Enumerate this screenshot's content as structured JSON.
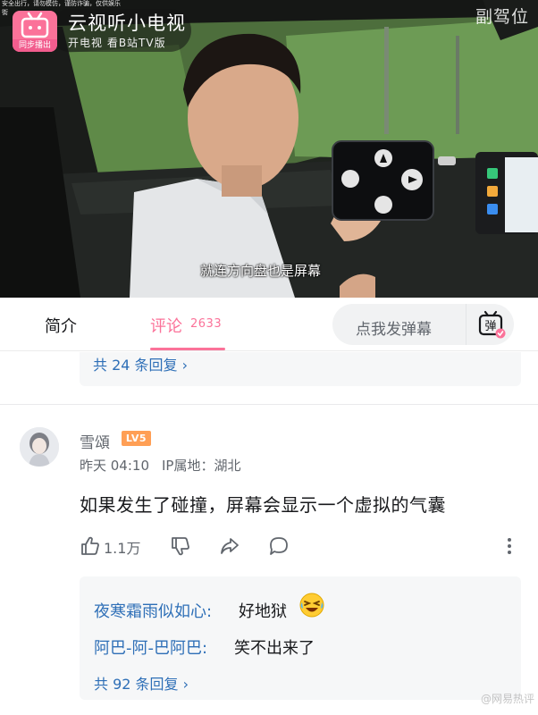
{
  "video": {
    "tiny_line1": "安全出行，请勿模仿，谨防诈骗，仅供娱乐",
    "tiny_line2": "街",
    "logo_label": "同步播出",
    "channel_title": "云视听小电视",
    "channel_subtitle": "开电视 看B站TV版",
    "corner_watermark": "副驾位",
    "subtitle": "就连方向盘也是屏幕"
  },
  "tabs": {
    "intro": "简介",
    "comments": "评论",
    "comments_count": "2633",
    "danmaku_placeholder": "点我发弹幕",
    "danmaku_icon_label": "弹"
  },
  "prev_reply": {
    "more_replies": "共 24 条回复 ›"
  },
  "comment": {
    "username": "雪頌",
    "level": "LV5",
    "time": "昨天 04:10",
    "ip": "IP属地：湖北",
    "text": "如果发生了碰撞，屏幕会显示一个虚拟的气囊",
    "likes": "1.1万"
  },
  "replies": [
    {
      "name": "夜寒霜雨似如心:",
      "text": "好地狱"
    },
    {
      "name": "阿巴-阿-巴阿巴:",
      "text": "笑不出来了"
    }
  ],
  "replies_more": "共 92 条回复 ›",
  "bottom_watermark": "@网易热评",
  "colors": {
    "accent": "#fb7299",
    "link": "#2e6fb7",
    "level_badge": "#ff9f55"
  }
}
